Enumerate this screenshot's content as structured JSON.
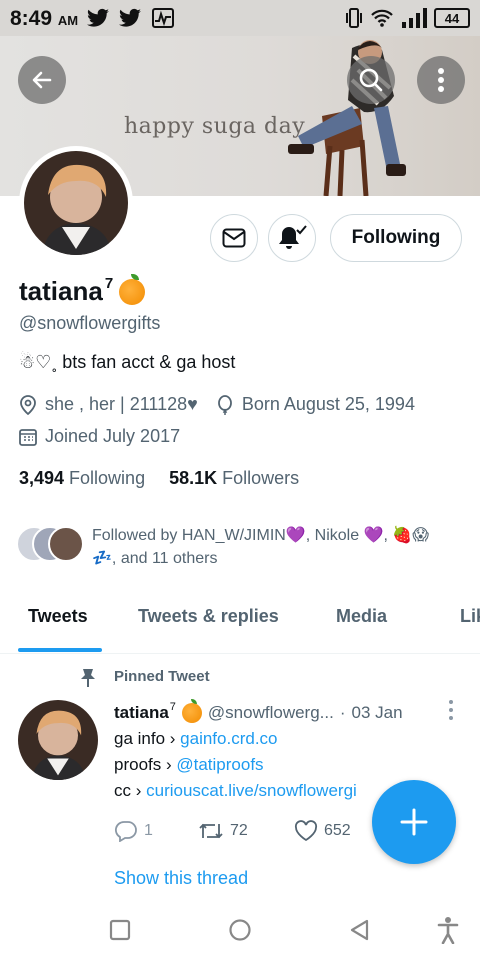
{
  "status_bar": {
    "time": "8:49",
    "ampm": "AM",
    "battery": "44"
  },
  "banner": {
    "text": "happy suga day"
  },
  "profile": {
    "name": "tatiana",
    "name_superscript": "7",
    "handle": "@snowflowergifts",
    "bio": "☃♡︎˳ bts fan acct & ga host",
    "location": "she , her | 211128♥",
    "birthday": "Born August 25, 1994",
    "joined": "Joined July 2017",
    "following_count": "3,494",
    "following_label": "Following",
    "followers_count": "58.1K",
    "followers_label": "Followers",
    "followed_by_line1": "Followed by HAN_W/JIMIN💜, Nikole 💜, 🍓😱",
    "followed_by_line2": "💤, and 11 others"
  },
  "buttons": {
    "following": "Following"
  },
  "tabs": [
    {
      "label": "Tweets"
    },
    {
      "label": "Tweets & replies"
    },
    {
      "label": "Media"
    },
    {
      "label": "Lik"
    }
  ],
  "pinned_tweet": {
    "pinned_label": "Pinned Tweet",
    "name": "tatiana",
    "name_superscript": "7",
    "handle": "@snowflowerg...",
    "separator": "·",
    "date": "03 Jan",
    "line1_prefix": "ga info › ",
    "line1_link": "gainfo.crd.co",
    "line2_prefix": "proofs › ",
    "line2_link": "@tatiproofs",
    "line3_prefix": "cc › ",
    "line3_link": "curiouscat.live/snowflowergi",
    "replies": "1",
    "retweets": "72",
    "likes": "652",
    "show_thread": "Show this thread"
  },
  "colors": {
    "accent": "#1d9bf0",
    "text_primary": "#0f1419",
    "text_secondary": "#536471"
  },
  "icons": {
    "back": "arrow-left-icon",
    "search": "search-icon",
    "more": "kebab-menu-icon",
    "message": "envelope-icon",
    "notifications": "bell-check-icon",
    "location": "location-pin-icon",
    "birthday": "balloon-icon",
    "joined": "calendar-icon",
    "pin": "pin-icon",
    "reply": "reply-icon",
    "retweet": "retweet-icon",
    "like": "heart-icon",
    "compose": "plus-icon"
  }
}
